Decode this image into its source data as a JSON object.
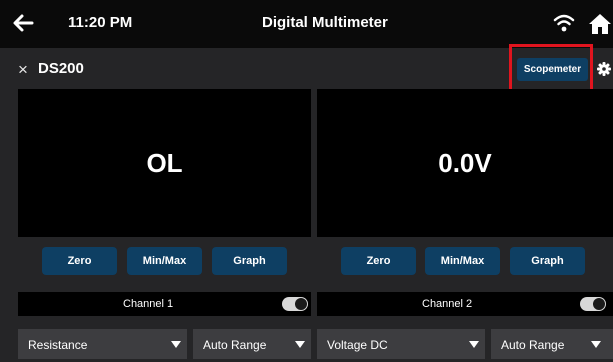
{
  "statusbar": {
    "time": "11:20 PM",
    "title": "Digital Multimeter"
  },
  "device": {
    "name": "DS200",
    "close_glyph": "×",
    "scopemeter_label": "Scopemeter"
  },
  "channels": [
    {
      "reading": "OL",
      "buttons": [
        "Zero",
        "Min/Max",
        "Graph"
      ],
      "label": "Channel 1",
      "enabled": true,
      "mode": "Resistance",
      "range": "Auto Range"
    },
    {
      "reading": "0.0V",
      "buttons": [
        "Zero",
        "Min/Max",
        "Graph"
      ],
      "label": "Channel 2",
      "enabled": true,
      "mode": "Voltage DC",
      "range": "Auto Range"
    }
  ],
  "colors": {
    "button": "#0e3f63",
    "highlight": "#e0141e",
    "display_bg": "#000000",
    "select_bg": "#3d3d40"
  }
}
